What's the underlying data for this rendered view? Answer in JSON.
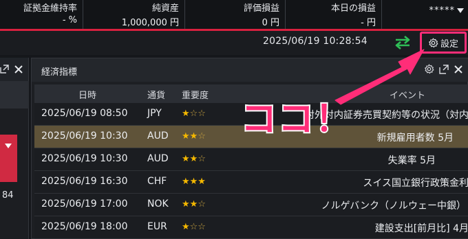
{
  "summary": {
    "margin_ratio_label": "証拠金維持率",
    "margin_ratio_value": "- %",
    "net_assets_label": "純資産",
    "net_assets_value": "1,000,000 円",
    "unrealized_pl_label": "評価損益",
    "unrealized_pl_value": "0 円",
    "today_pl_label": "本日の損益",
    "today_pl_value": "- 円",
    "user_masked": "*****"
  },
  "statusbar": {
    "datetime": "2025/06/19 10:28:54",
    "settings_label": "設定"
  },
  "left_panel": {
    "number_fragment": "84"
  },
  "panel": {
    "title": "経済指標",
    "columns": {
      "datetime": "日時",
      "currency": "通貨",
      "importance": "重要度",
      "event": "イベント"
    },
    "rows": [
      {
        "datetime": "2025/06/19 08:50",
        "currency": "JPY",
        "stars_on": "★",
        "stars_off": "☆☆",
        "event": "対外対内証券売買契約等の状況（対内",
        "selected": false
      },
      {
        "datetime": "2025/06/19 10:30",
        "currency": "AUD",
        "stars_on": "★★",
        "stars_off": "☆",
        "event": "新規雇用者数 5月",
        "selected": true
      },
      {
        "datetime": "2025/06/19 10:30",
        "currency": "AUD",
        "stars_on": "★★",
        "stars_off": "☆",
        "event": "失業率 5月",
        "selected": false
      },
      {
        "datetime": "2025/06/19 16:30",
        "currency": "CHF",
        "stars_on": "★★★",
        "stars_off": "",
        "event": "スイス国立銀行政策金利",
        "selected": false
      },
      {
        "datetime": "2025/06/19 17:00",
        "currency": "NOK",
        "stars_on": "★★",
        "stars_off": "☆",
        "event": "ノルゲバンク（ノルウェー中銀）",
        "selected": false
      },
      {
        "datetime": "2025/06/19 18:00",
        "currency": "EUR",
        "stars_on": "★",
        "stars_off": "☆☆",
        "event": "建設支出[前月比] 4月",
        "selected": false
      }
    ]
  },
  "annotation": {
    "text": "ココ！",
    "color": "#ff2d78"
  },
  "colors": {
    "accent_red": "#d9213f",
    "highlight": "#ff2d78",
    "sync_green": "#2fbf57",
    "star": "#f5b800",
    "selected_row": "#5f5339"
  }
}
